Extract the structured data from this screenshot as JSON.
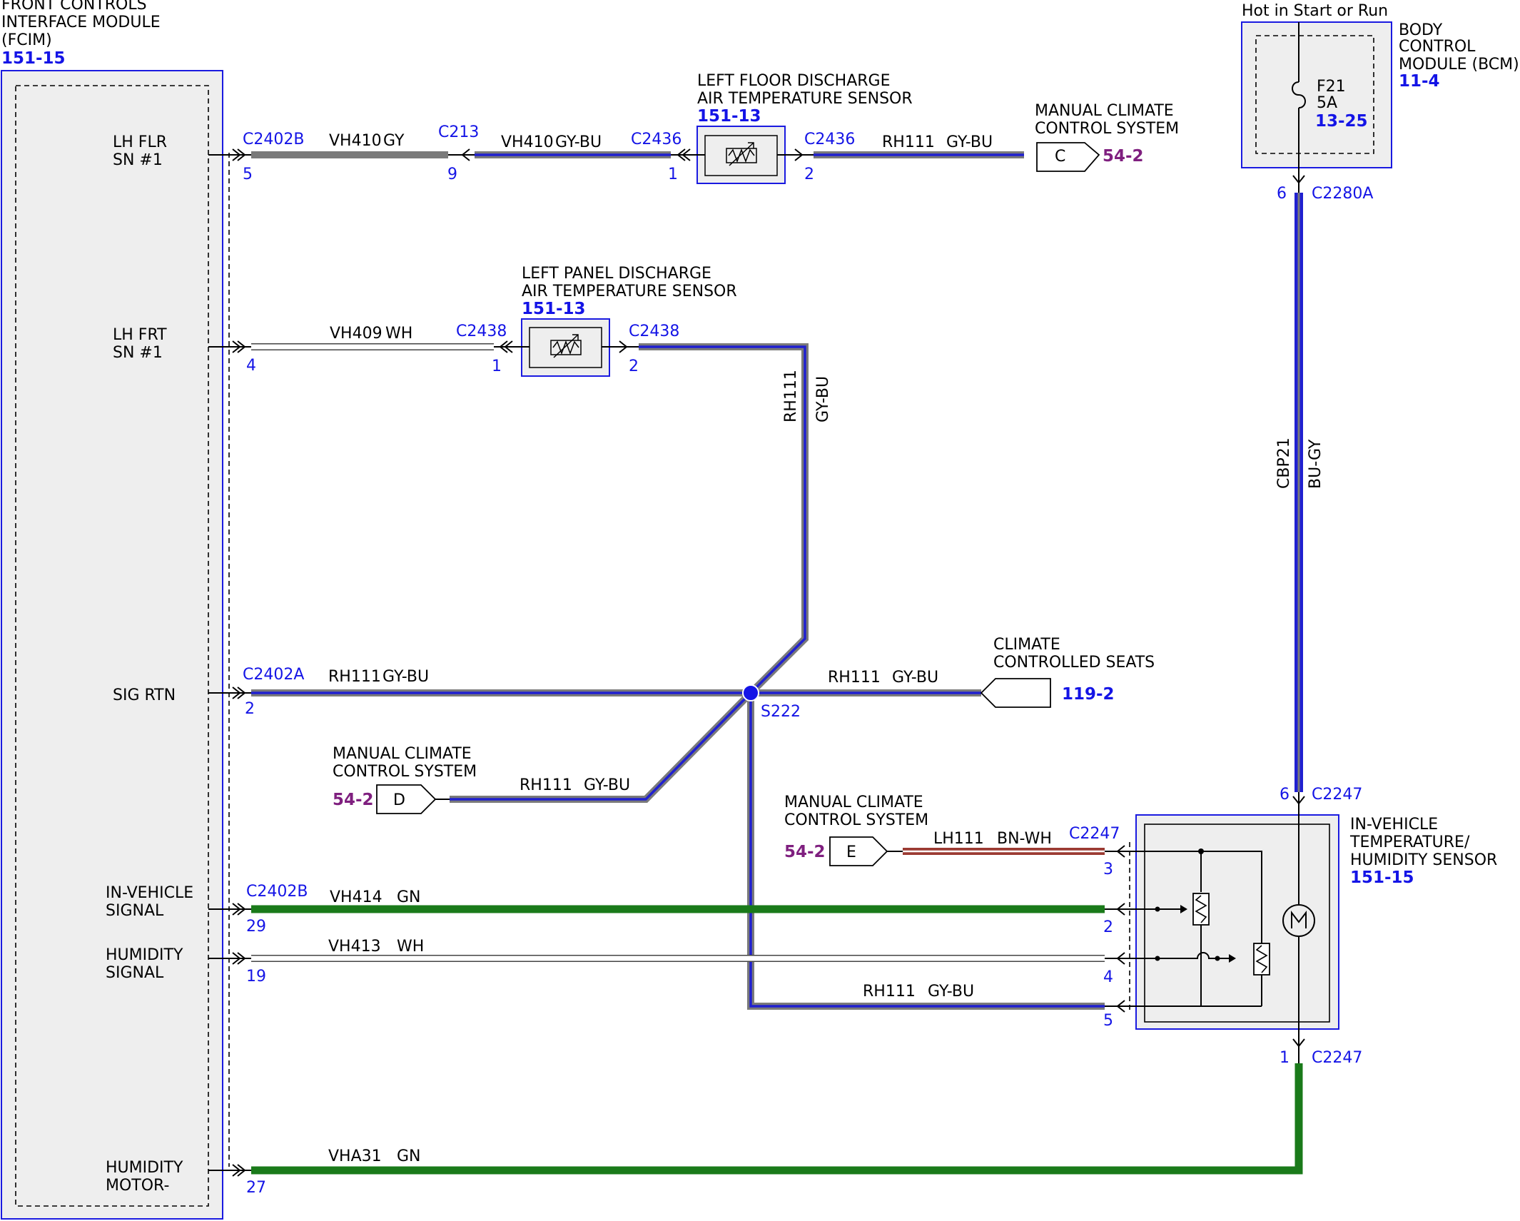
{
  "colors": {
    "gray": "#7a7a7a",
    "gray_blue_outer": "#7a7a7a",
    "gray_blue_inner": "#2020d0",
    "white_wire": "#ffffff",
    "green": "#1a7a1a",
    "brown_white": "#9b3a32",
    "blue_gray": "#2020d0",
    "reference_blue": "#1414e6",
    "reference_purple": "#7f1f7f"
  },
  "fcim": {
    "title_lines": [
      "FRONT CONTROLS",
      "INTERFACE MODULE",
      "(FCIM)"
    ],
    "ref": "151-15",
    "pins": [
      {
        "name_lines": [
          "LH FLR",
          "SN #1"
        ],
        "connector": "C2402B",
        "pin": "5"
      },
      {
        "name_lines": [
          "LH FRT",
          "SN #1"
        ],
        "connector": "",
        "pin": "4"
      },
      {
        "name_lines": [
          "SIG RTN"
        ],
        "connector": "C2402A",
        "pin": "2"
      },
      {
        "name_lines": [
          "IN-VEHICLE",
          "SIGNAL"
        ],
        "connector": "C2402B",
        "pin": "29"
      },
      {
        "name_lines": [
          "HUMIDITY",
          "SIGNAL"
        ],
        "connector": "",
        "pin": "19"
      },
      {
        "name_lines": [
          "HUMIDITY",
          "MOTOR-"
        ],
        "connector": "",
        "pin": "27"
      }
    ]
  },
  "floor_sensor": {
    "title_lines": [
      "LEFT FLOOR DISCHARGE",
      "AIR TEMPERATURE SENSOR"
    ],
    "ref": "151-13",
    "connector": "C2436",
    "pin_in": "1",
    "pin_out": "2"
  },
  "panel_sensor": {
    "title_lines": [
      "LEFT PANEL DISCHARGE",
      "AIR TEMPERATURE SENSOR"
    ],
    "ref": "151-13",
    "connector": "C2438",
    "pin_in": "1",
    "pin_out": "2"
  },
  "inline_c213": {
    "connector": "C213",
    "pin": "9"
  },
  "bcm": {
    "supply_label": "Hot in Start or Run",
    "title_lines": [
      "BODY",
      "CONTROL",
      "MODULE (BCM)"
    ],
    "ref": "11-4",
    "fuse_lines": [
      "F21",
      "5A"
    ],
    "fuse_ref": "13-25",
    "connector": "C2280A",
    "pin": "6"
  },
  "in_vehicle_sensor": {
    "title_lines": [
      "IN-VEHICLE",
      "TEMPERATURE/",
      "HUMIDITY SENSOR"
    ],
    "ref": "151-15",
    "connector": "C2247",
    "top_pin": "6",
    "bottom_pin": "1",
    "side_pins": [
      "3",
      "2",
      "4",
      "5"
    ]
  },
  "splice": {
    "name": "S222"
  },
  "wires": {
    "vh410_gy": {
      "circuit": "VH410",
      "color": "GY"
    },
    "vh410_gybu": {
      "circuit": "VH410",
      "color": "GY-BU"
    },
    "rh111_top": {
      "circuit": "RH111",
      "color": "GY-BU"
    },
    "vh409": {
      "circuit": "VH409",
      "color": "WH"
    },
    "rh111_vertical": {
      "circuit": "RH111",
      "color": "GY-BU"
    },
    "rh111_sig": {
      "circuit": "RH111",
      "color": "GY-BU"
    },
    "rh111_seats": {
      "circuit": "RH111",
      "color": "GY-BU"
    },
    "rh111_d": {
      "circuit": "RH111",
      "color": "GY-BU"
    },
    "lh111": {
      "circuit": "LH111",
      "color": "BN-WH"
    },
    "vh414": {
      "circuit": "VH414",
      "color": "GN"
    },
    "vh413": {
      "circuit": "VH413",
      "color": "WH"
    },
    "rh111_sensor": {
      "circuit": "RH111",
      "color": "GY-BU"
    },
    "vha31": {
      "circuit": "VHA31",
      "color": "GN"
    },
    "cbp21": {
      "circuit": "CBP21",
      "color": "BU-GY"
    }
  },
  "references": {
    "manual_c": {
      "lines": [
        "MANUAL CLIMATE",
        "CONTROL SYSTEM"
      ],
      "letter": "C",
      "ref": "54-2"
    },
    "seats": {
      "lines": [
        "CLIMATE",
        "CONTROLLED SEATS"
      ],
      "ref": "119-2"
    },
    "manual_d": {
      "lines": [
        "MANUAL CLIMATE",
        "CONTROL SYSTEM"
      ],
      "letter": "D",
      "ref": "54-2"
    },
    "manual_e": {
      "lines": [
        "MANUAL CLIMATE",
        "CONTROL SYSTEM"
      ],
      "letter": "E",
      "ref": "54-2"
    }
  }
}
